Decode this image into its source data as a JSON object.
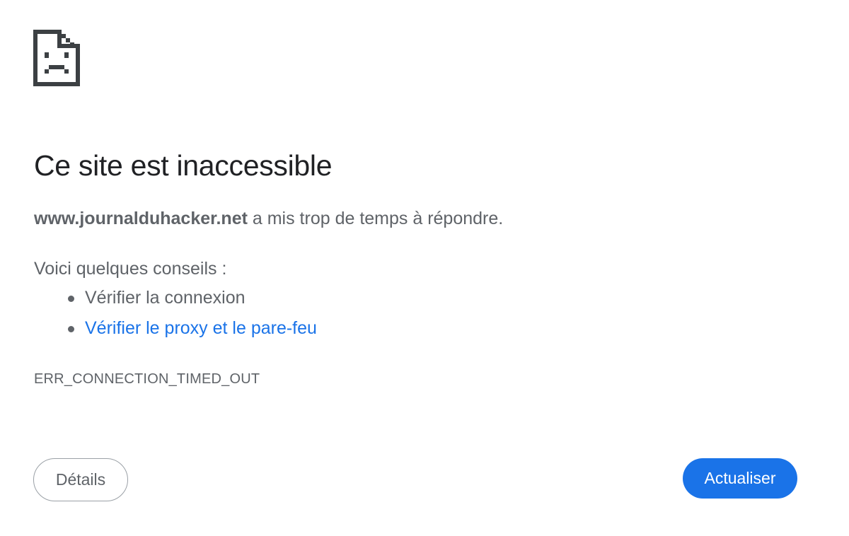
{
  "icon": {
    "name": "sad-page-icon",
    "color": "#3c4043"
  },
  "main": {
    "title": "Ce site est inaccessible",
    "summary": {
      "host": "www.journalduhacker.net",
      "message": " a mis trop de temps à répondre."
    },
    "suggestions_heading": "Voici quelques conseils :",
    "suggestions": [
      {
        "label": "Vérifier la connexion",
        "is_link": false
      },
      {
        "label": "Vérifier le proxy et le pare-feu",
        "is_link": true
      }
    ],
    "error_code": "ERR_CONNECTION_TIMED_OUT"
  },
  "buttons": {
    "details_label": "Détails",
    "reload_label": "Actualiser"
  },
  "colors": {
    "accent": "#1a73e8",
    "text_primary": "#202124",
    "text_secondary": "#5f6368"
  }
}
